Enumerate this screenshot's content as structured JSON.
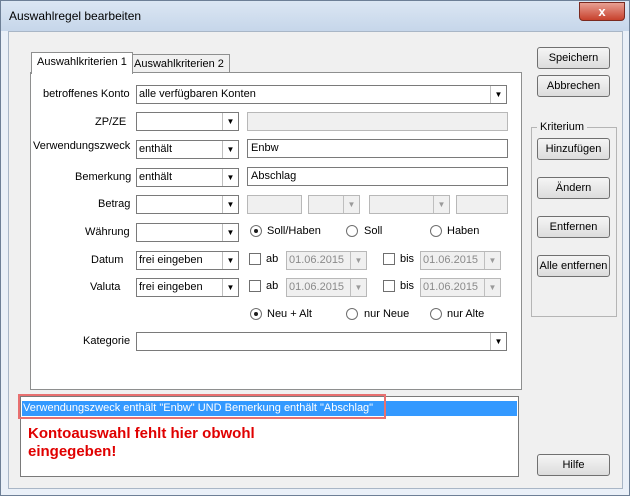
{
  "window": {
    "title": "Auswahlregel bearbeiten",
    "close_glyph": "x"
  },
  "tabs": [
    {
      "label": "Auswahlkriterien 1"
    },
    {
      "label": "Auswahlkriterien 2"
    }
  ],
  "form": {
    "konto": {
      "label": "betroffenes Konto",
      "value": "alle verfügbaren Konten"
    },
    "zpze": {
      "label": "ZP/ZE",
      "operator": "",
      "value": ""
    },
    "verwendungszweck": {
      "label": "Verwendungszweck",
      "operator": "enthält",
      "value": "Enbw"
    },
    "bemerkung": {
      "label": "Bemerkung",
      "operator": "enthält",
      "value": "Abschlag"
    },
    "betrag": {
      "label": "Betrag",
      "operator": "",
      "value1": "",
      "op2": "",
      "op3": "",
      "value2": ""
    },
    "waehrung": {
      "label": "Währung",
      "operator": "",
      "options": [
        "Soll/Haben",
        "Soll",
        "Haben"
      ],
      "selected": "Soll/Haben"
    },
    "datum": {
      "label": "Datum",
      "operator": "frei eingeben",
      "ab_label": "ab",
      "ab_value": "01.06.2015",
      "bis_label": "bis",
      "bis_value": "01.06.2015"
    },
    "valuta": {
      "label": "Valuta",
      "operator": "frei eingeben",
      "ab_label": "ab",
      "ab_value": "01.06.2015",
      "bis_label": "bis",
      "bis_value": "01.06.2015"
    },
    "neu": {
      "options": [
        "Neu + Alt",
        "nur Neue",
        "nur Alte"
      ],
      "selected": "Neu + Alt"
    },
    "kategorie": {
      "label": "Kategorie",
      "value": ""
    }
  },
  "buttons": {
    "speichern": "Speichern",
    "abbrechen": "Abbrechen",
    "kriterium_title": "Kriterium",
    "hinzufuegen": "Hinzufügen",
    "aendern": "Ändern",
    "entfernen": "Entfernen",
    "alle_entfernen": "Alle entfernen",
    "hilfe": "Hilfe"
  },
  "result": {
    "rule_text": "Verwendungszweck enthält \"Enbw\" UND Bemerkung enthält \"Abschlag\"",
    "annotation": "Kontoauswahl fehlt hier obwohl eingegeben!"
  },
  "colors": {
    "selection": "#3399ff",
    "annotation": "#e00000",
    "highlight_box": "#e87070"
  }
}
